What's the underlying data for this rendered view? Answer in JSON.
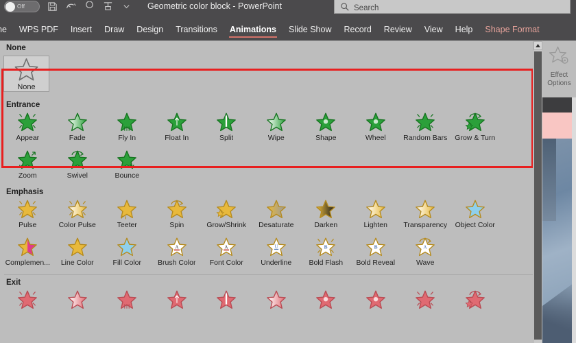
{
  "titlebar": {
    "autosave_label": "Off",
    "document_title": "Geometric color block",
    "title_separator": "-",
    "app_name": "PowerPoint",
    "qat_icons": [
      "save-icon",
      "undo-icon",
      "redo-icon",
      "start-presentation-icon",
      "customize-qat-icon"
    ]
  },
  "search": {
    "placeholder": "Search",
    "icon": "search-icon"
  },
  "tabs": [
    {
      "label": "ne",
      "state": "clipped"
    },
    {
      "label": "WPS PDF",
      "state": "normal"
    },
    {
      "label": "Insert",
      "state": "normal"
    },
    {
      "label": "Draw",
      "state": "normal"
    },
    {
      "label": "Design",
      "state": "normal"
    },
    {
      "label": "Transitions",
      "state": "normal"
    },
    {
      "label": "Animations",
      "state": "active"
    },
    {
      "label": "Slide Show",
      "state": "normal"
    },
    {
      "label": "Record",
      "state": "normal"
    },
    {
      "label": "Review",
      "state": "normal"
    },
    {
      "label": "View",
      "state": "normal"
    },
    {
      "label": "Help",
      "state": "normal"
    },
    {
      "label": "Shape Format",
      "state": "contextual"
    }
  ],
  "gallery": {
    "sections": [
      {
        "id": "none",
        "label": "None",
        "items": [
          {
            "label": "None",
            "icon": "star-none-icon",
            "color": "#8c8c8c"
          }
        ]
      },
      {
        "id": "entrance",
        "label": "Entrance",
        "highlighted": true,
        "color": "#2ba03a",
        "items": [
          {
            "label": "Appear",
            "icon": "star-appear-icon"
          },
          {
            "label": "Fade",
            "icon": "star-fade-icon"
          },
          {
            "label": "Fly In",
            "icon": "star-fly-in-icon"
          },
          {
            "label": "Float In",
            "icon": "star-float-in-icon"
          },
          {
            "label": "Split",
            "icon": "star-split-icon"
          },
          {
            "label": "Wipe",
            "icon": "star-wipe-icon"
          },
          {
            "label": "Shape",
            "icon": "star-shape-icon"
          },
          {
            "label": "Wheel",
            "icon": "star-wheel-icon"
          },
          {
            "label": "Random Bars",
            "icon": "star-random-bars-icon"
          },
          {
            "label": "Grow & Turn",
            "icon": "star-grow-turn-icon"
          },
          {
            "label": "Zoom",
            "icon": "star-zoom-icon"
          },
          {
            "label": "Swivel",
            "icon": "star-swivel-icon"
          },
          {
            "label": "Bounce",
            "icon": "star-bounce-icon"
          }
        ]
      },
      {
        "id": "emphasis",
        "label": "Emphasis",
        "highlighted": false,
        "color": "#e8b93c",
        "items": [
          {
            "label": "Pulse",
            "icon": "star-pulse-icon"
          },
          {
            "label": "Color Pulse",
            "icon": "star-color-pulse-icon"
          },
          {
            "label": "Teeter",
            "icon": "star-teeter-icon"
          },
          {
            "label": "Spin",
            "icon": "star-spin-icon"
          },
          {
            "label": "Grow/Shrink",
            "icon": "star-grow-shrink-icon"
          },
          {
            "label": "Desaturate",
            "icon": "star-desaturate-icon"
          },
          {
            "label": "Darken",
            "icon": "star-darken-icon"
          },
          {
            "label": "Lighten",
            "icon": "star-lighten-icon"
          },
          {
            "label": "Transparency",
            "icon": "star-transparency-icon"
          },
          {
            "label": "Object Color",
            "icon": "star-object-color-icon"
          },
          {
            "label": "Complemen...",
            "icon": "star-complementary-color-icon"
          },
          {
            "label": "Line Color",
            "icon": "star-line-color-icon"
          },
          {
            "label": "Fill Color",
            "icon": "star-fill-color-icon"
          },
          {
            "label": "Brush Color",
            "icon": "star-brush-color-icon"
          },
          {
            "label": "Font Color",
            "icon": "star-font-color-icon"
          },
          {
            "label": "Underline",
            "icon": "star-underline-icon"
          },
          {
            "label": "Bold Flash",
            "icon": "star-bold-flash-icon"
          },
          {
            "label": "Bold Reveal",
            "icon": "star-bold-reveal-icon"
          },
          {
            "label": "Wave",
            "icon": "star-wave-icon"
          }
        ]
      },
      {
        "id": "exit",
        "label": "Exit",
        "highlighted": false,
        "color": "#e06a72",
        "items": [
          {
            "label": "",
            "icon": "star-disappear-icon"
          },
          {
            "label": "",
            "icon": "star-fade-out-icon"
          },
          {
            "label": "",
            "icon": "star-fly-out-icon"
          },
          {
            "label": "",
            "icon": "star-float-out-icon"
          },
          {
            "label": "",
            "icon": "star-split-out-icon"
          },
          {
            "label": "",
            "icon": "star-wipe-out-icon"
          },
          {
            "label": "",
            "icon": "star-shape-out-icon"
          },
          {
            "label": "",
            "icon": "star-wheel-out-icon"
          },
          {
            "label": "",
            "icon": "star-random-bars-out-icon"
          },
          {
            "label": "",
            "icon": "star-shrink-turn-icon"
          }
        ]
      }
    ]
  },
  "scrollbar": {
    "up_arrow_icon": "scroll-up-arrow-icon",
    "orientation": "vertical"
  },
  "effect_options": {
    "label_line1": "Effect",
    "label_line2": "Options",
    "icon": "star-gear-icon",
    "enabled": false
  },
  "colors": {
    "ribbon_bg": "#4b4a4c",
    "gallery_bg": "#bdbdbd",
    "highlight_red": "#e81f1f",
    "active_tab_underline": "#d4736a",
    "entrance_green": "#2ba03a",
    "emphasis_yellow": "#e8b93c",
    "exit_red": "#e06a72"
  }
}
